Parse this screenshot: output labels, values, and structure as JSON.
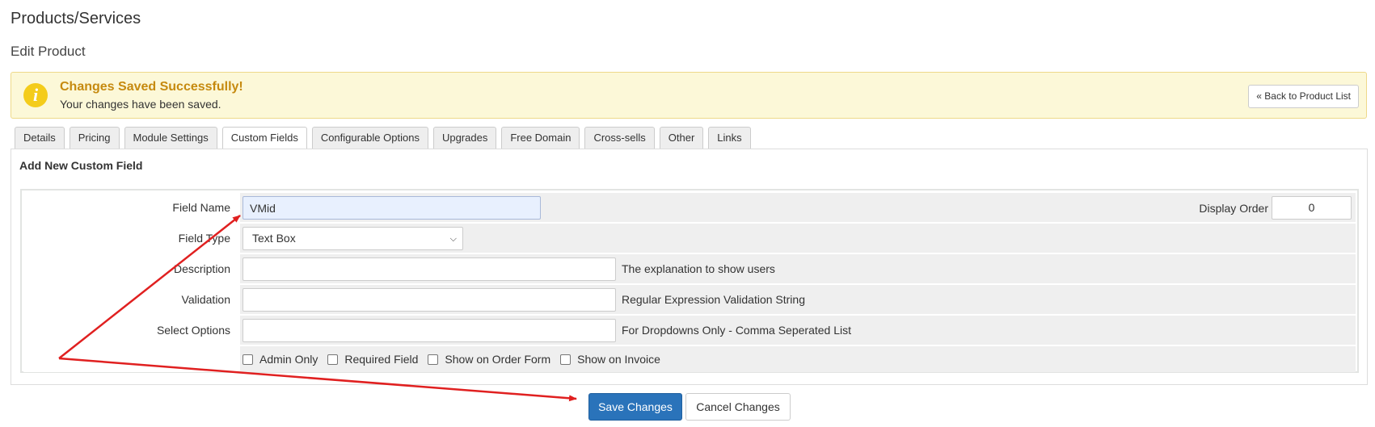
{
  "header": {
    "title": "Products/Services",
    "subtitle": "Edit Product"
  },
  "alert": {
    "icon": "info-icon",
    "icon_glyph": "i",
    "title": "Changes Saved Successfully!",
    "message": "Your changes have been saved.",
    "back_label": "« Back to Product List"
  },
  "tabs": [
    {
      "label": "Details"
    },
    {
      "label": "Pricing"
    },
    {
      "label": "Module Settings"
    },
    {
      "label": "Custom Fields",
      "active": true
    },
    {
      "label": "Configurable Options"
    },
    {
      "label": "Upgrades"
    },
    {
      "label": "Free Domain"
    },
    {
      "label": "Cross-sells"
    },
    {
      "label": "Other"
    },
    {
      "label": "Links"
    }
  ],
  "form": {
    "section_title": "Add New Custom Field",
    "field_name": {
      "label": "Field Name",
      "value": "VMid"
    },
    "display_order": {
      "label": "Display Order",
      "value": "0"
    },
    "field_type": {
      "label": "Field Type",
      "value": "Text Box"
    },
    "description": {
      "label": "Description",
      "value": "",
      "hint": "The explanation to show users"
    },
    "validation": {
      "label": "Validation",
      "value": "",
      "hint": "Regular Expression Validation String"
    },
    "select_options": {
      "label": "Select Options",
      "value": "",
      "hint": "For Dropdowns Only - Comma Seperated List"
    },
    "checkboxes": [
      {
        "label": "Admin Only",
        "checked": false
      },
      {
        "label": "Required Field",
        "checked": false
      },
      {
        "label": "Show on Order Form",
        "checked": false
      },
      {
        "label": "Show on Invoice",
        "checked": false
      }
    ]
  },
  "actions": {
    "save_label": "Save Changes",
    "cancel_label": "Cancel Changes"
  },
  "colors": {
    "accent": "#2a73ba",
    "alert_bg": "#fcf8d8",
    "alert_title": "#c68a0f",
    "annotation_arrow": "#e02020"
  }
}
